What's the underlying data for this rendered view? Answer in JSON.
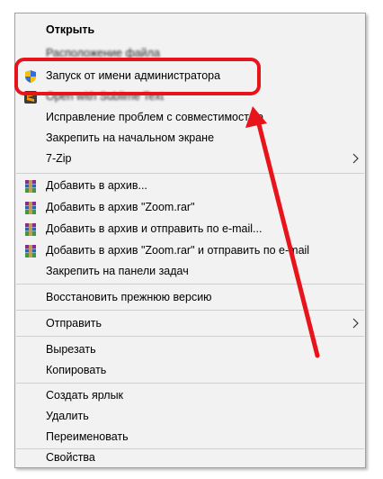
{
  "context_menu": {
    "open": "Открыть",
    "obscured_item": "Расположение файла",
    "run_as_admin": "Запуск от имени администратора",
    "open_with_sublime": "Open with Sublime Text",
    "troubleshoot_compat": "Исправление проблем с совместимостью",
    "pin_to_start": "Закрепить на начальном экране",
    "seven_zip": "7-Zip",
    "add_to_archive": "Добавить в архив...",
    "add_to_zoom_rar": "Добавить в архив \"Zoom.rar\"",
    "add_and_email": "Добавить в архив и отправить по e-mail...",
    "add_zoom_rar_and_email": "Добавить в архив \"Zoom.rar\" и отправить по e-mail",
    "pin_to_taskbar": "Закрепить на панели задач",
    "restore_previous": "Восстановить прежнюю версию",
    "send_to": "Отправить",
    "cut": "Вырезать",
    "copy": "Копировать",
    "create_shortcut": "Создать ярлык",
    "delete": "Удалить",
    "rename": "Переименовать",
    "properties": "Свойства"
  },
  "icons": {
    "run_as_admin": "uac-shield-icon",
    "sublime": "sublime-text-icon",
    "winrar": "winrar-archive-icon",
    "submenu": "chevron-right-icon"
  },
  "colors": {
    "menu_background": "#f2f2f2",
    "annotation": "#e8141b"
  }
}
